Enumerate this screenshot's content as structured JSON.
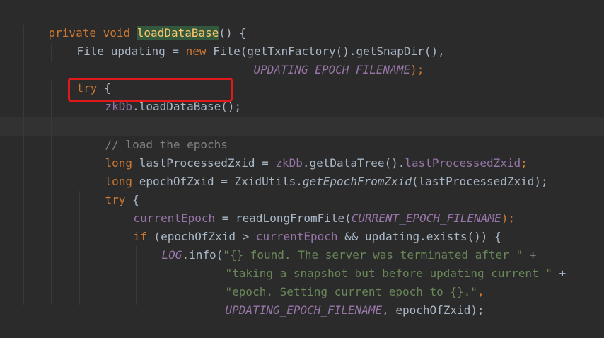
{
  "code": {
    "l1": {
      "mod1": "private",
      "mod2": "void",
      "method": "loadDataBase",
      "rest": "() {"
    },
    "l2": {
      "type": "File updating = ",
      "new_kw": "new",
      "call": " File(getTxnFactory().getSnapDir(),"
    },
    "l3": {
      "const": "UPDATING_EPOCH_FILENAME",
      "end": ");"
    },
    "l4": {
      "kw": "try",
      "brace": " {"
    },
    "l5": {
      "field": "zkDb",
      "call": ".loadDataBase();"
    },
    "l7": {
      "comment": "// load the epochs"
    },
    "l8": {
      "type_kw": "long",
      "name": " lastProcessedZxid = ",
      "field": "zkDb",
      "call": ".getDataTree().",
      "field2": "lastProcessedZxid",
      "end": ";"
    },
    "l9": {
      "type_kw": "long",
      "name": " epochOfZxid = ZxidUtils.",
      "static_call": "getEpochFromZxid",
      "end": "(lastProcessedZxid);"
    },
    "l10": {
      "kw": "try",
      "brace": " {"
    },
    "l11": {
      "field": "currentEpoch",
      "mid": " = readLongFromFile(",
      "const": "CURRENT_EPOCH_FILENAME",
      "end": ");"
    },
    "l12": {
      "kw": "if",
      "cond1": " (epochOfZxid > ",
      "field": "currentEpoch",
      "cond2": " && updating.exists()) {"
    },
    "l13": {
      "const": "LOG",
      "call": ".info(",
      "str": "\"{} found. The server was terminated after \"",
      "end": " +"
    },
    "l14": {
      "str": "\"taking a snapshot but before updating current \"",
      "end": " +"
    },
    "l15": {
      "str": "\"epoch. Setting current epoch to {}.\"",
      "end": ","
    },
    "l16": {
      "const": "UPDATING_EPOCH_FILENAME",
      "end": ", epochOfZxid);"
    }
  },
  "colors": {
    "background": "#2b2b2b",
    "keyword": "#cc7832",
    "method": "#ffc66d",
    "field": "#9876aa",
    "string": "#6a8759",
    "comment": "#808080",
    "highlight_box": "#e01a1a"
  }
}
